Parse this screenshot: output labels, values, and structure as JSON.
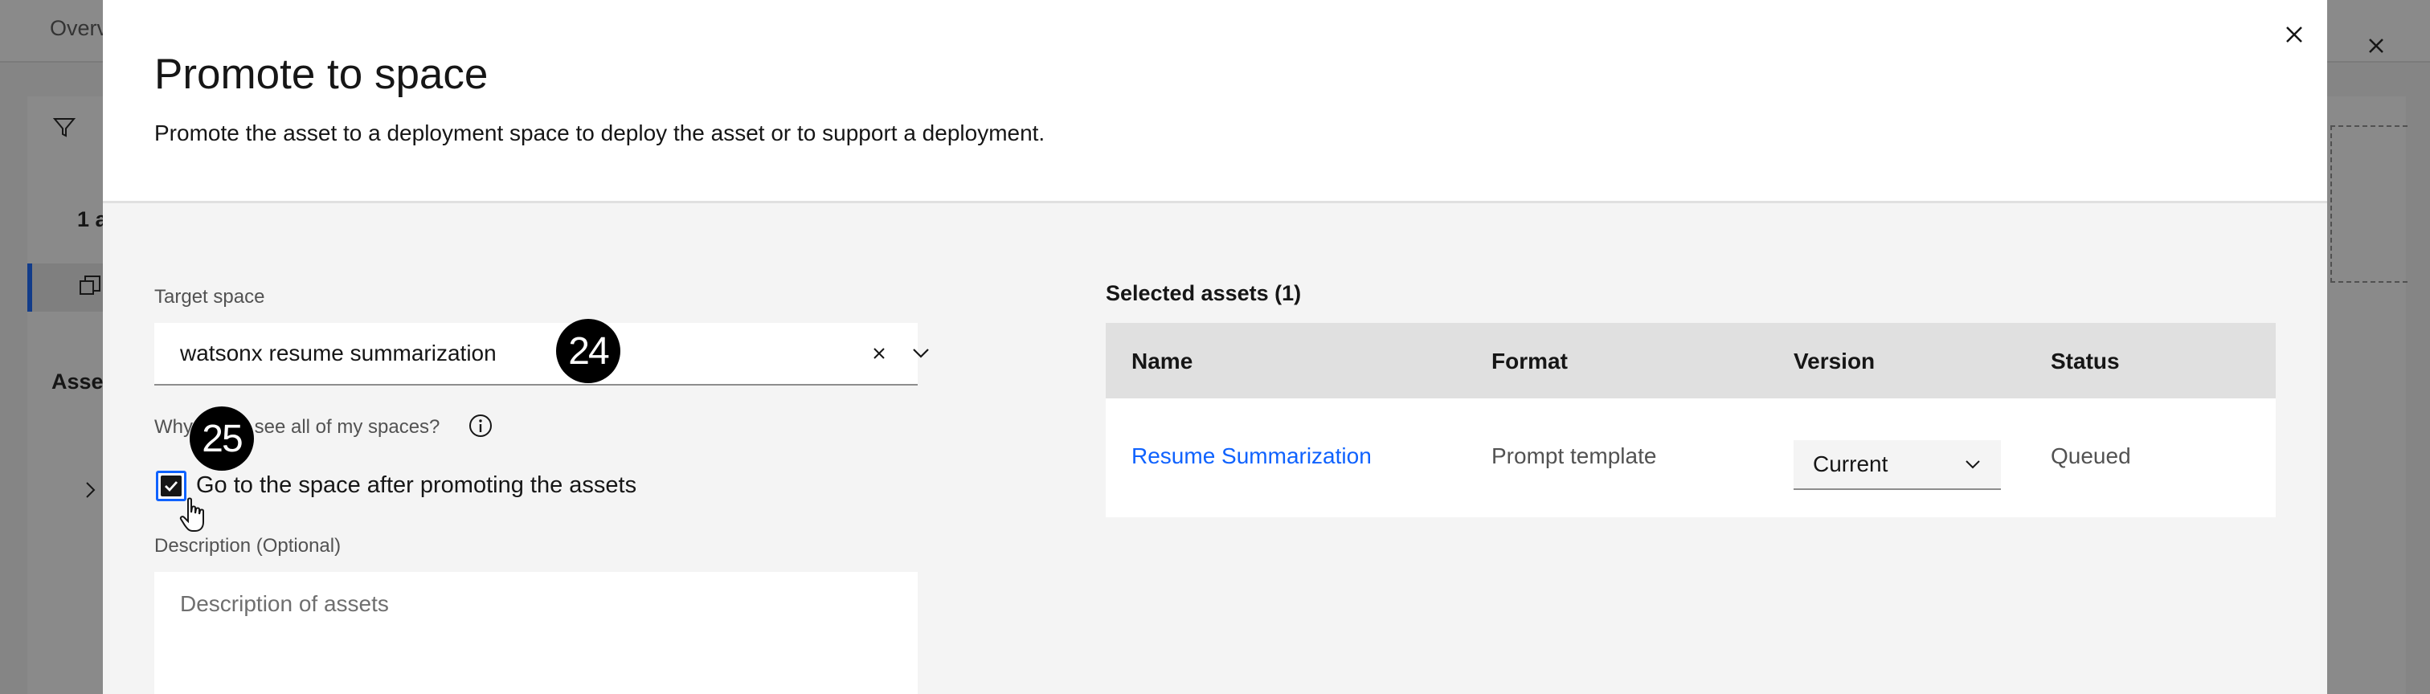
{
  "background": {
    "tab_label": "Overview",
    "asset_count": "1 a",
    "section_label": "Asse"
  },
  "modal": {
    "title": "Promote to space",
    "subtitle": "Promote the asset to a deployment space to deploy the asset or to support a deployment.",
    "target_space": {
      "label": "Target space",
      "value": "watsonx resume summarization"
    },
    "why_link": "Why can't I see all of my spaces?",
    "go_to_space": {
      "label": "Go to the space after promoting the assets",
      "checked": true
    },
    "description": {
      "label": "Description (Optional)",
      "placeholder": "Description of assets"
    },
    "selected_assets": {
      "title": "Selected assets (1)",
      "columns": [
        "Name",
        "Format",
        "Version",
        "Status"
      ],
      "rows": [
        {
          "name": "Resume Summarization",
          "format": "Prompt template",
          "version": "Current",
          "status": "Queued"
        }
      ]
    }
  },
  "annotations": {
    "badge_1": "24",
    "badge_2": "25"
  },
  "colors": {
    "accent": "#0f62fe",
    "modal_bg": "#f4f4f4",
    "table_header": "#e0e0e0"
  },
  "icons": [
    "close-icon",
    "chevron-down-icon",
    "info-icon",
    "checkmark-icon",
    "hand-cursor-icon",
    "filter-icon",
    "copy-icon",
    "chevron-right-icon"
  ]
}
